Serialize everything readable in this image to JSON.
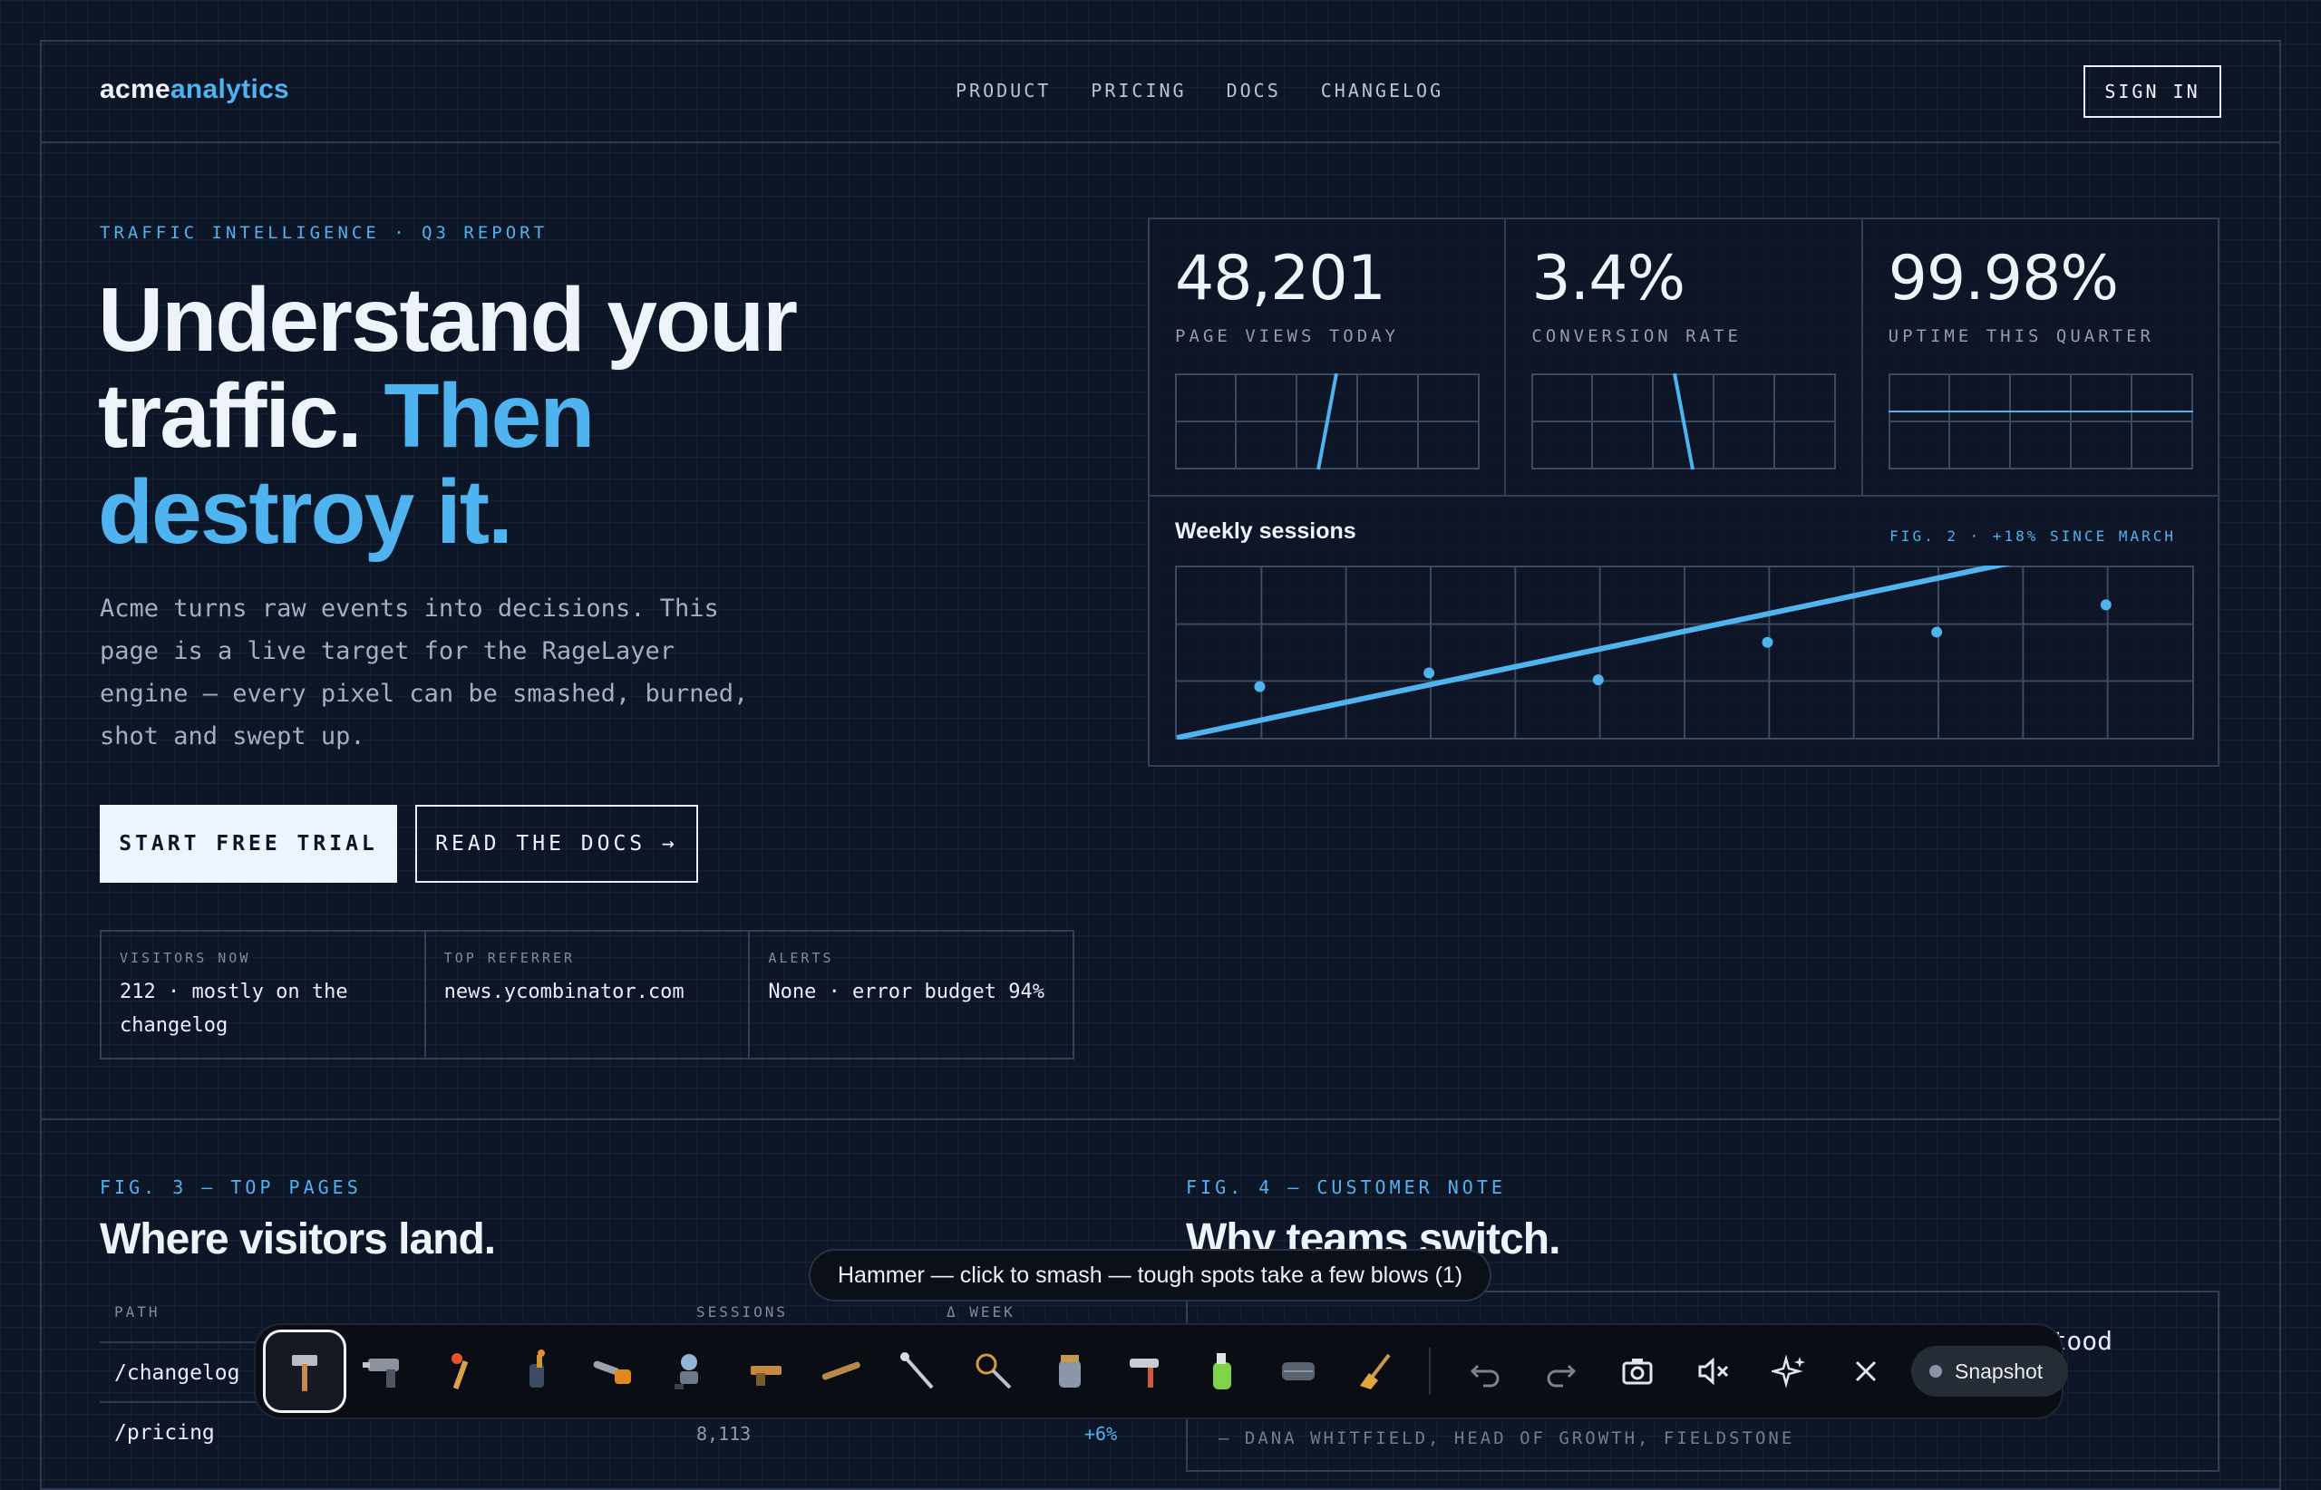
{
  "header": {
    "logo_part1": "acme",
    "logo_part2": "analytics",
    "nav": [
      "PRODUCT",
      "PRICING",
      "DOCS",
      "CHANGELOG"
    ],
    "signin_label": "SIGN IN"
  },
  "hero": {
    "eyebrow": "TRAFFIC INTELLIGENCE · Q3 REPORT",
    "title_line1": "Understand your",
    "title_line2_a": "traffic. ",
    "title_line2_b": "Then",
    "title_line3": "destroy it.",
    "body": "Acme turns raw events into decisions. This page is a live target for the RageLayer engine — every pixel can be smashed, burned, shot and swept up.",
    "cta_primary": "START FREE TRIAL",
    "cta_secondary": "READ THE DOCS →"
  },
  "stats": [
    {
      "label": "VISITORS NOW",
      "value": "212 · mostly on the changelog"
    },
    {
      "label": "TOP REFERRER",
      "value": "news.ycombinator.com"
    },
    {
      "label": "ALERTS",
      "value": "None · error budget 94%"
    }
  ],
  "kpis": [
    {
      "value": "48,201",
      "caption": "PAGE VIEWS TODAY"
    },
    {
      "value": "3.4%",
      "caption": "CONVERSION RATE"
    },
    {
      "value": "99.98%",
      "caption": "UPTIME THIS QUARTER"
    }
  ],
  "sessions": {
    "title": "Weekly sessions",
    "fig_label": "FIG. 2 · +18% SINCE MARCH"
  },
  "chart_data": {
    "type": "scatter",
    "title": "Weekly sessions",
    "x": [
      1,
      2,
      3,
      4,
      5,
      6
    ],
    "y": [
      0.3,
      0.38,
      0.34,
      0.56,
      0.62,
      0.78
    ],
    "trendline": {
      "x": [
        0,
        12
      ],
      "y": [
        0.0,
        1.25
      ]
    },
    "ylim": [
      0,
      1
    ],
    "grid": true,
    "annotation": "FIG. 2 · +18% SINCE MARCH",
    "accent": "#4fb3f0"
  },
  "top_pages": {
    "fig_label": "FIG. 3 — TOP PAGES",
    "title": "Where visitors land.",
    "columns": [
      "PATH",
      "SESSIONS",
      "Δ WEEK"
    ],
    "rows": [
      {
        "path": "/changelog",
        "sessions": "",
        "delta": ""
      },
      {
        "path": "/pricing",
        "sessions": "8,113",
        "delta": "+6%"
      }
    ]
  },
  "customer_note": {
    "fig_label": "FIG. 4 — CUSTOMER NOTE",
    "title": "Why teams switch.",
    "quote_visible": "erstood",
    "author": "— DANA WHITFIELD, HEAD OF GROWTH, FIELDSTONE"
  },
  "tooltip": "Hammer — click to smash — tough spots take a few blows (1)",
  "toolbar": {
    "tools": [
      "hammer-icon",
      "nail-gun-icon",
      "match-icon",
      "blowtorch-icon",
      "chainsaw-icon",
      "laser-icon",
      "pistol-icon",
      "shotgun-icon",
      "wand-icon",
      "net-icon",
      "jar-icon",
      "roller-icon",
      "spray-icon",
      "tape-icon",
      "broom-icon"
    ],
    "snapshot_label": "Snapshot"
  },
  "colors": {
    "background": "#0d1626",
    "accent": "#4fb3f0",
    "border": "#2f3f57",
    "text": "#e8eef7"
  }
}
